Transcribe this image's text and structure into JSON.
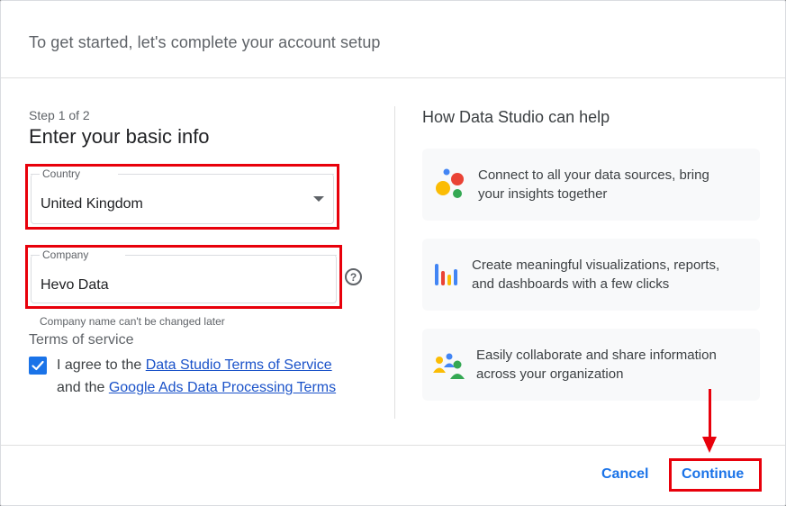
{
  "dialog": {
    "title": "To get started, let's complete your account setup"
  },
  "form": {
    "step": "Step 1 of 2",
    "heading": "Enter your basic info",
    "country": {
      "label": "Country",
      "value": "United Kingdom"
    },
    "company": {
      "label": "Company",
      "value": "Hevo Data",
      "hint": "Company name can't be changed later"
    },
    "tos": {
      "heading": "Terms of service",
      "checked": true,
      "line1_prefix": "I agree to the ",
      "line1_link": "Data Studio Terms of Service",
      "line2_prefix": "and the ",
      "line2_link": "Google Ads Data Processing Terms"
    }
  },
  "help": {
    "title": "How Data Studio can help",
    "cards": [
      {
        "icon": "data-sources-icon",
        "line1": "Connect to all your data sources, bring",
        "line2": "your insights together"
      },
      {
        "icon": "bar-chart-icon",
        "line1": "Create meaningful visualizations, reports,",
        "line2": "and dashboards with a few clicks"
      },
      {
        "icon": "people-icon",
        "line1": "Easily collaborate and share information",
        "line2": "across your organization"
      }
    ]
  },
  "footer": {
    "cancel_label": "Cancel",
    "continue_label": "Continue"
  },
  "colors": {
    "accent": "#1a73e8",
    "annotation": "#e8000b",
    "card_bg": "#f8f9fa"
  }
}
